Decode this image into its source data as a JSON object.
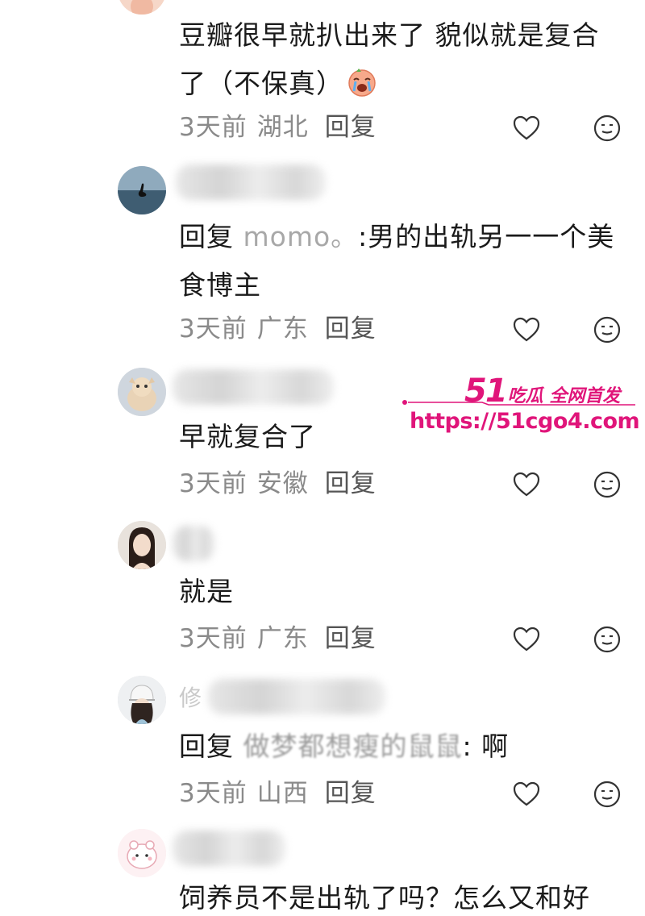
{
  "comments": [
    {
      "text": "豆瓣很早就扒出来了 貌似就是复合了（不保真）",
      "time": "3天前",
      "location": "湖北",
      "reply_label": "回复"
    },
    {
      "reply_prefix": "回复",
      "reply_to": "momo。",
      "reply_colon": ":",
      "text": "男的出轨另一一个美食博主",
      "time": "3天前",
      "location": "广东",
      "reply_label": "回复"
    },
    {
      "text": "早就复合了",
      "time": "3天前",
      "location": "安徽",
      "reply_label": "回复"
    },
    {
      "text": "就是",
      "time": "3天前",
      "location": "广东",
      "reply_label": "回复"
    },
    {
      "nick_visible": "修",
      "reply_prefix": "回复",
      "reply_to": "做梦都想瘦的鼠鼠",
      "reply_colon": ":",
      "text": "啊",
      "time": "3天前",
      "location": "山西",
      "reply_label": "回复"
    },
    {
      "text": "饲养员不是出轨了吗？怎么又和好"
    }
  ],
  "icons": {
    "like": "heart-outline-icon",
    "emoji": "neutral-face-icon",
    "crying": "crying-face-emoji"
  },
  "watermark": {
    "brand_number": "51",
    "brand_text": "吃瓜 全网首发",
    "url": "https://51cgo4.com",
    "color": "#e0157a"
  }
}
